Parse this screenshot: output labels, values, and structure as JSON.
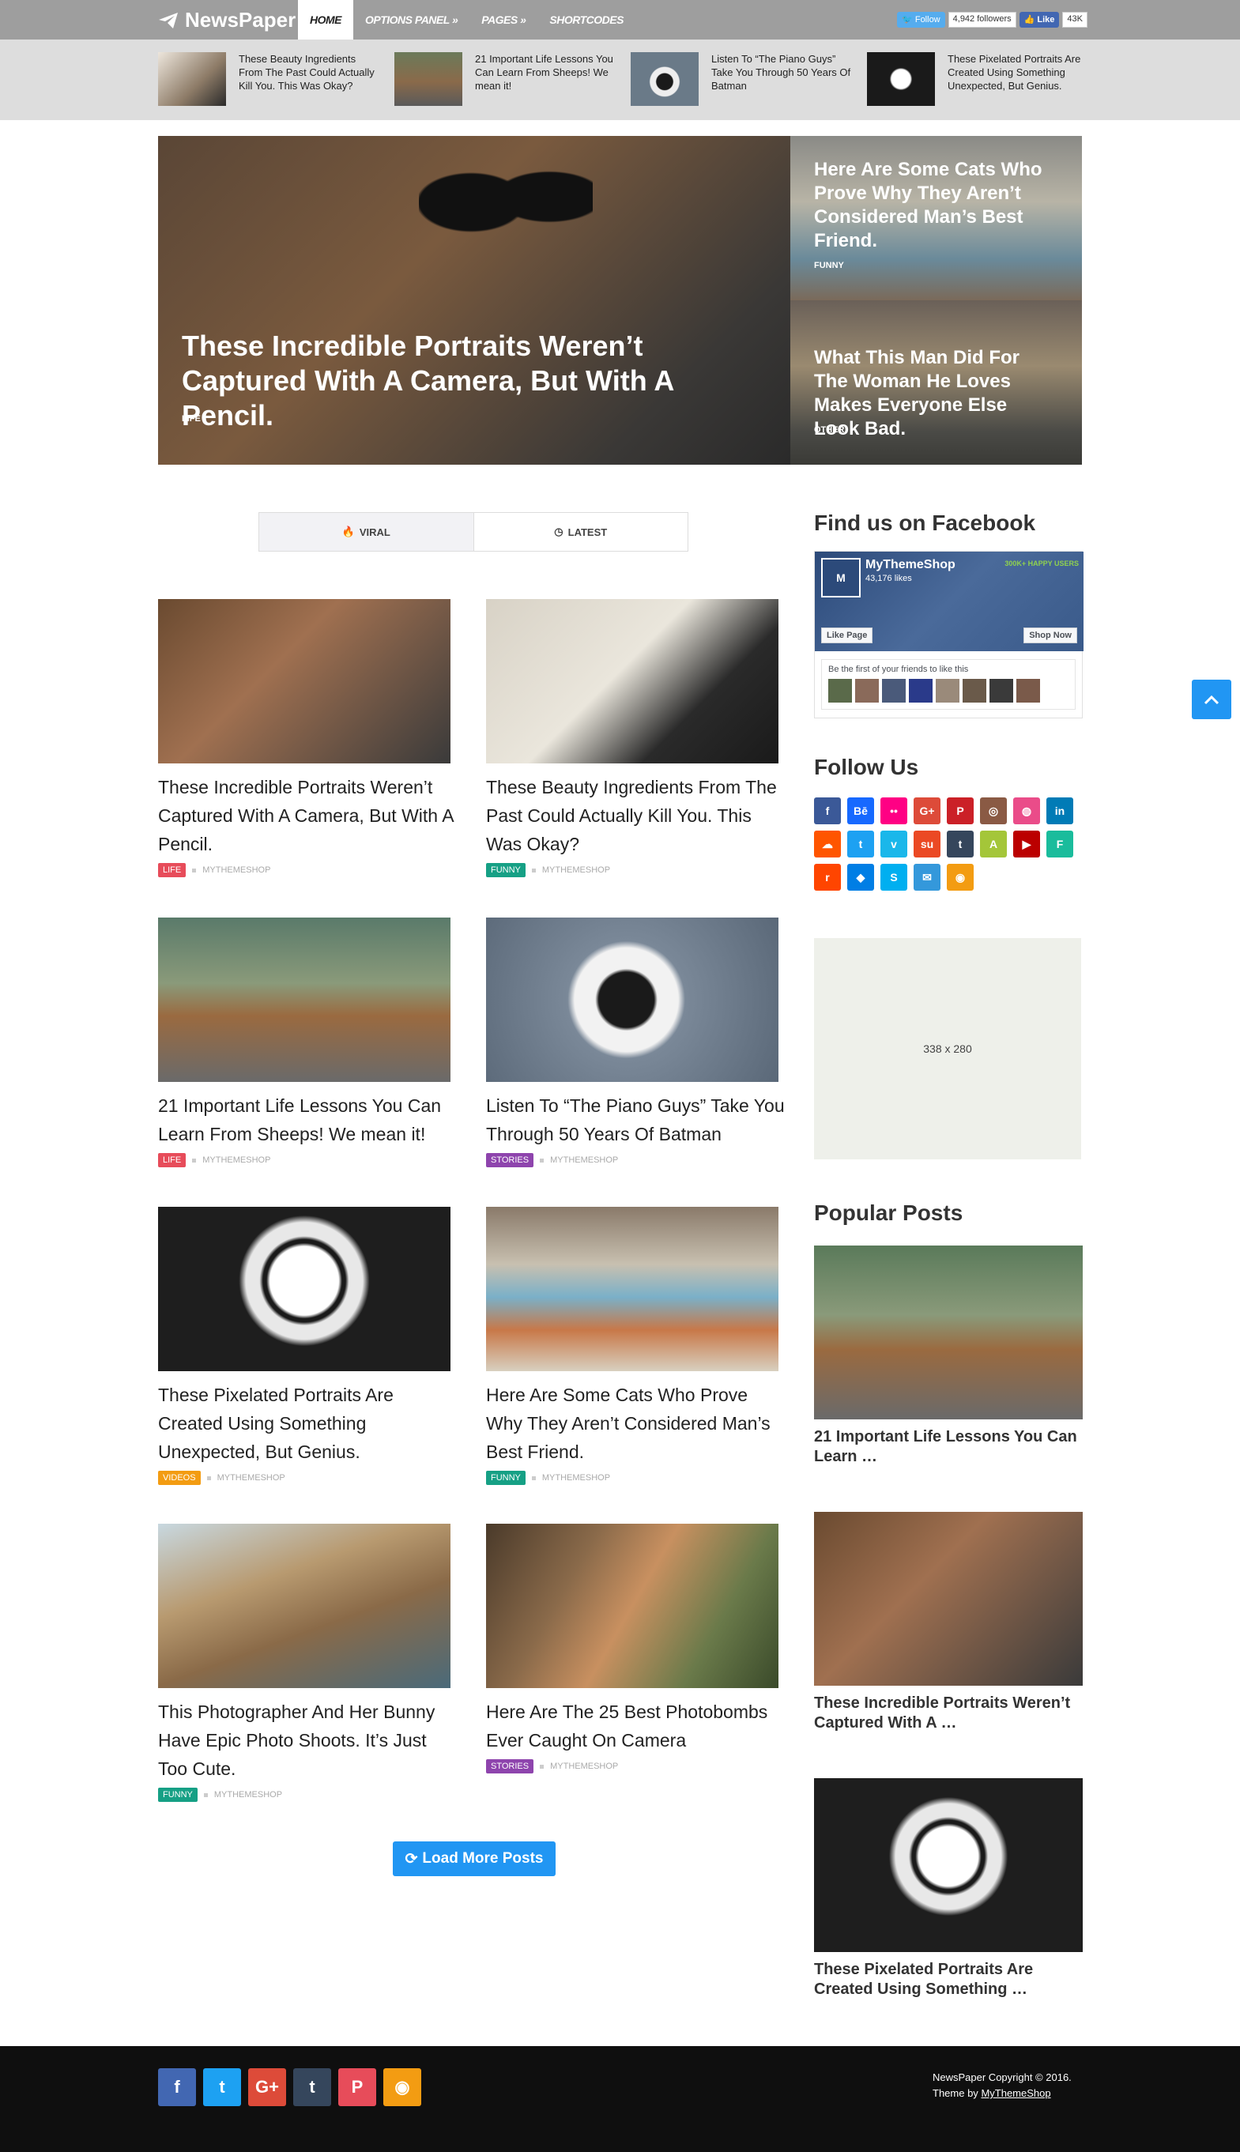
{
  "brand": {
    "name": "NewsPaper"
  },
  "nav": [
    "HOME",
    "OPTIONS PANEL »",
    "PAGES »",
    "SHORTCODES"
  ],
  "social_top": {
    "follow_label": "Follow",
    "followers": "4,942 followers",
    "like_label": "Like",
    "likes": "43K"
  },
  "strip": [
    {
      "title": "These Beauty Ingredients From The Past Could Actually Kill You. This Was Okay?"
    },
    {
      "title": "21 Important Life Lessons You Can Learn From Sheeps! We mean it!"
    },
    {
      "title": "Listen To “The Piano Guys” Take You Through 50 Years Of Batman"
    },
    {
      "title": "These Pixelated Portraits Are Created Using Something Unexpected, But Genius."
    }
  ],
  "hero": {
    "main": {
      "title": "These Incredible Portraits Weren’t Captured With A Camera, But With A Pencil.",
      "category": "LIFE"
    },
    "side": [
      {
        "title": "Here Are Some Cats Who Prove Why They Aren’t Considered Man’s Best Friend.",
        "category": "FUNNY"
      },
      {
        "title": "What This Man Did For The Woman He Loves Makes Everyone Else Look Bad.",
        "category": "OTHER"
      }
    ]
  },
  "tabs": [
    "VIRAL",
    "LATEST"
  ],
  "posts": [
    {
      "title": "These Incredible Portraits Weren’t Captured With A Camera, But With A Pencil.",
      "category": "LIFE",
      "author": "MYTHEMESHOP",
      "color": "#e74c5a"
    },
    {
      "title": "These Beauty Ingredients From The Past Could Actually Kill You. This Was Okay?",
      "category": "FUNNY",
      "author": "MYTHEMESHOP",
      "color": "#16a085"
    },
    {
      "title": "21 Important Life Lessons You Can Learn From Sheeps! We mean it!",
      "category": "LIFE",
      "author": "MYTHEMESHOP",
      "color": "#e74c5a"
    },
    {
      "title": "Listen To “The Piano Guys” Take You Through 50 Years Of Batman",
      "category": "STORIES",
      "author": "MYTHEMESHOP",
      "color": "#8e44ad"
    },
    {
      "title": "These Pixelated Portraits Are Created Using Something Unexpected, But Genius.",
      "category": "VIDEOS",
      "author": "MYTHEMESHOP",
      "color": "#f39c12"
    },
    {
      "title": "Here Are Some Cats Who Prove Why They Aren’t Considered Man’s Best Friend.",
      "category": "FUNNY",
      "author": "MYTHEMESHOP",
      "color": "#16a085"
    },
    {
      "title": "This Photographer And Her Bunny Have Epic Photo Shoots. It’s Just Too Cute.",
      "category": "FUNNY",
      "author": "MYTHEMESHOP",
      "color": "#16a085"
    },
    {
      "title": "Here Are The 25 Best Photobombs Ever Caught On Camera",
      "category": "STORIES",
      "author": "MYTHEMESHOP",
      "color": "#8e44ad"
    }
  ],
  "load_more": "Load More Posts",
  "sidebar": {
    "facebook": {
      "heading": "Find us on Facebook",
      "page_name": "MyThemeShop",
      "likes": "43,176 likes",
      "badge": "300K+ HAPPY USERS",
      "like_page": "Like Page",
      "shop_now": "Shop Now",
      "friends_text": "Be the first of your friends to like this"
    },
    "follow": {
      "heading": "Follow Us"
    },
    "ad": {
      "label": "338 x 280"
    },
    "popular": {
      "heading": "Popular Posts",
      "items": [
        {
          "title": "21 Important Life Lessons You Can Learn …"
        },
        {
          "title": "These Incredible Portraits Weren’t Captured With A …"
        },
        {
          "title": "These Pixelated Portraits Are Created Using Something …"
        }
      ]
    }
  },
  "footer": {
    "copyright": "NewsPaper Copyright © 2016.",
    "theme_by": "Theme by",
    "theme_link": "MyThemeShop"
  },
  "colors": {
    "accent": "#2196f3",
    "topbar": "#9e9e9e"
  }
}
